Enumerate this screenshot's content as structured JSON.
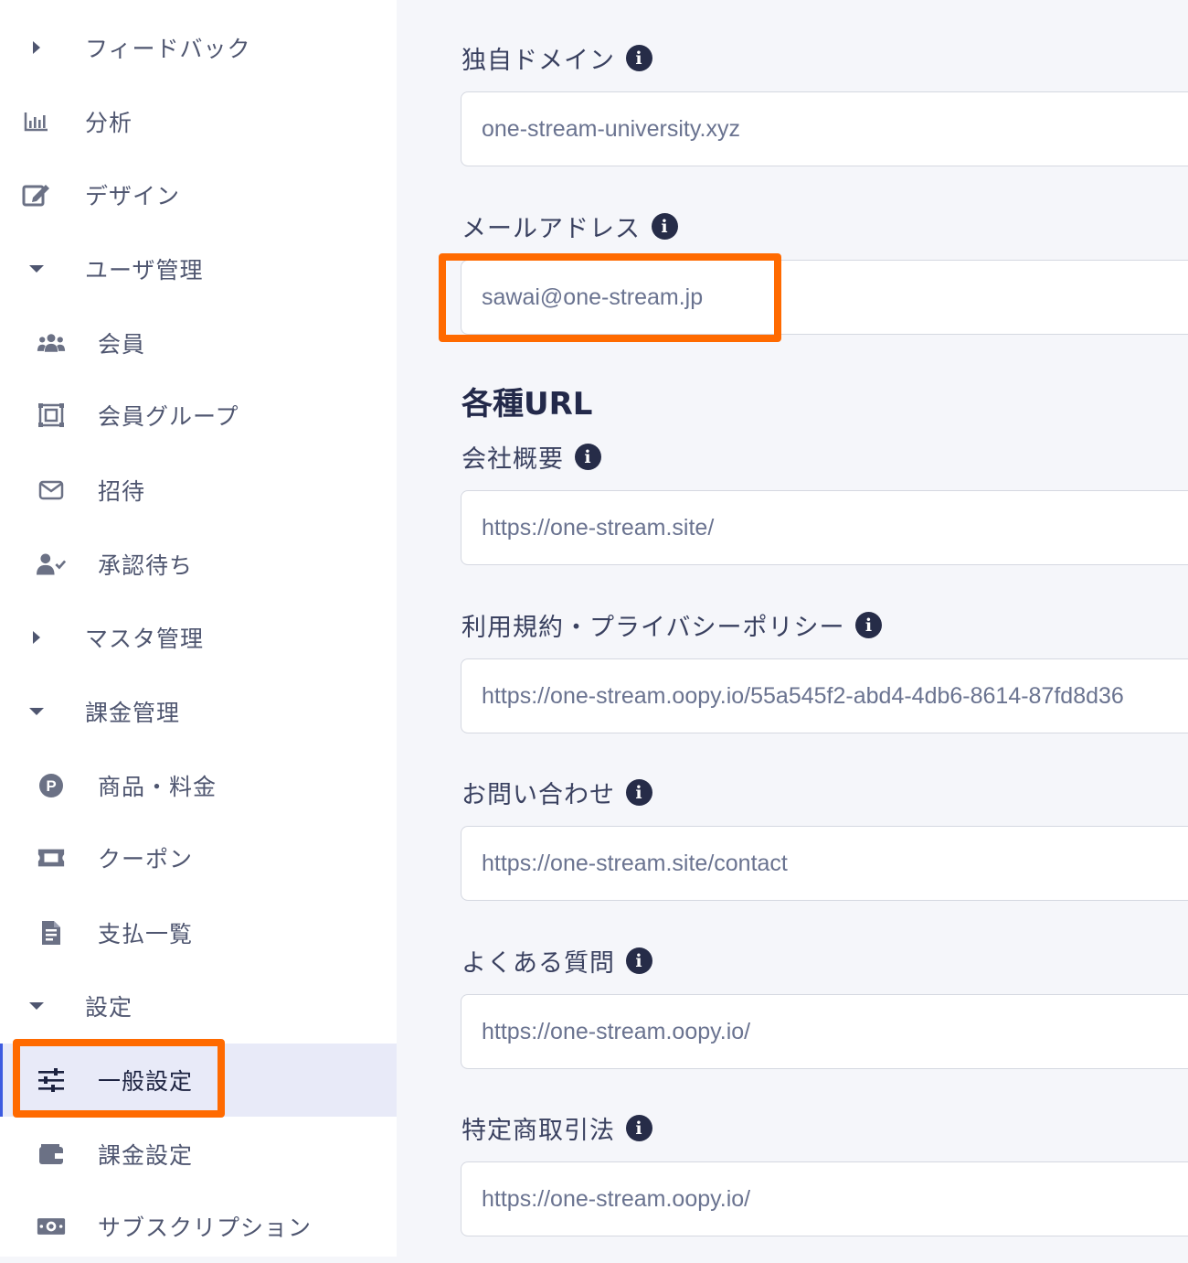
{
  "sidebar": {
    "feedback": {
      "label": "フィードバック",
      "icon": "caret-right-icon"
    },
    "analytics": {
      "label": "分析",
      "icon": "bar-chart-icon"
    },
    "design": {
      "label": "デザイン",
      "icon": "edit-icon"
    },
    "user_management": {
      "label": "ユーザ管理",
      "icon": "caret-down-icon"
    },
    "members": {
      "label": "会員",
      "icon": "users-icon"
    },
    "member_groups": {
      "label": "会員グループ",
      "icon": "object-group-icon"
    },
    "invite": {
      "label": "招待",
      "icon": "envelope-icon"
    },
    "pending_approval": {
      "label": "承認待ち",
      "icon": "user-check-icon"
    },
    "master_management": {
      "label": "マスタ管理",
      "icon": "caret-right-icon"
    },
    "billing_management": {
      "label": "課金管理",
      "icon": "caret-down-icon"
    },
    "products_pricing": {
      "label": "商品・料金",
      "icon": "p-circle-icon"
    },
    "coupons": {
      "label": "クーポン",
      "icon": "ticket-icon"
    },
    "payments_list": {
      "label": "支払一覧",
      "icon": "file-invoice-icon"
    },
    "settings": {
      "label": "設定",
      "icon": "caret-down-icon"
    },
    "general_settings": {
      "label": "一般設定",
      "icon": "sliders-icon"
    },
    "billing_settings": {
      "label": "課金設定",
      "icon": "wallet-icon"
    },
    "subscription": {
      "label": "サブスクリプション",
      "icon": "money-bill-icon"
    }
  },
  "main": {
    "custom_domain": {
      "label": "独自ドメイン",
      "value": "one-stream-university.xyz"
    },
    "email": {
      "label": "メールアドレス",
      "value": "sawai@one-stream.jp"
    },
    "urls_title": "各種URL",
    "company_profile": {
      "label": "会社概要",
      "value": "https://one-stream.site/"
    },
    "terms_privacy": {
      "label": "利用規約・プライバシーポリシー",
      "value": "https://one-stream.oopy.io/55a545f2-abd4-4db6-8614-87fd8d36"
    },
    "contact": {
      "label": "お問い合わせ",
      "value": "https://one-stream.site/contact"
    },
    "faq": {
      "label": "よくある質問",
      "value": "https://one-stream.oopy.io/"
    },
    "commercial_law": {
      "label": "特定商取引法",
      "value": "https://one-stream.oopy.io/"
    }
  },
  "colors": {
    "highlight": "#ff6a00",
    "active_bg": "#e8eaf8",
    "info_icon": "#262c48"
  }
}
